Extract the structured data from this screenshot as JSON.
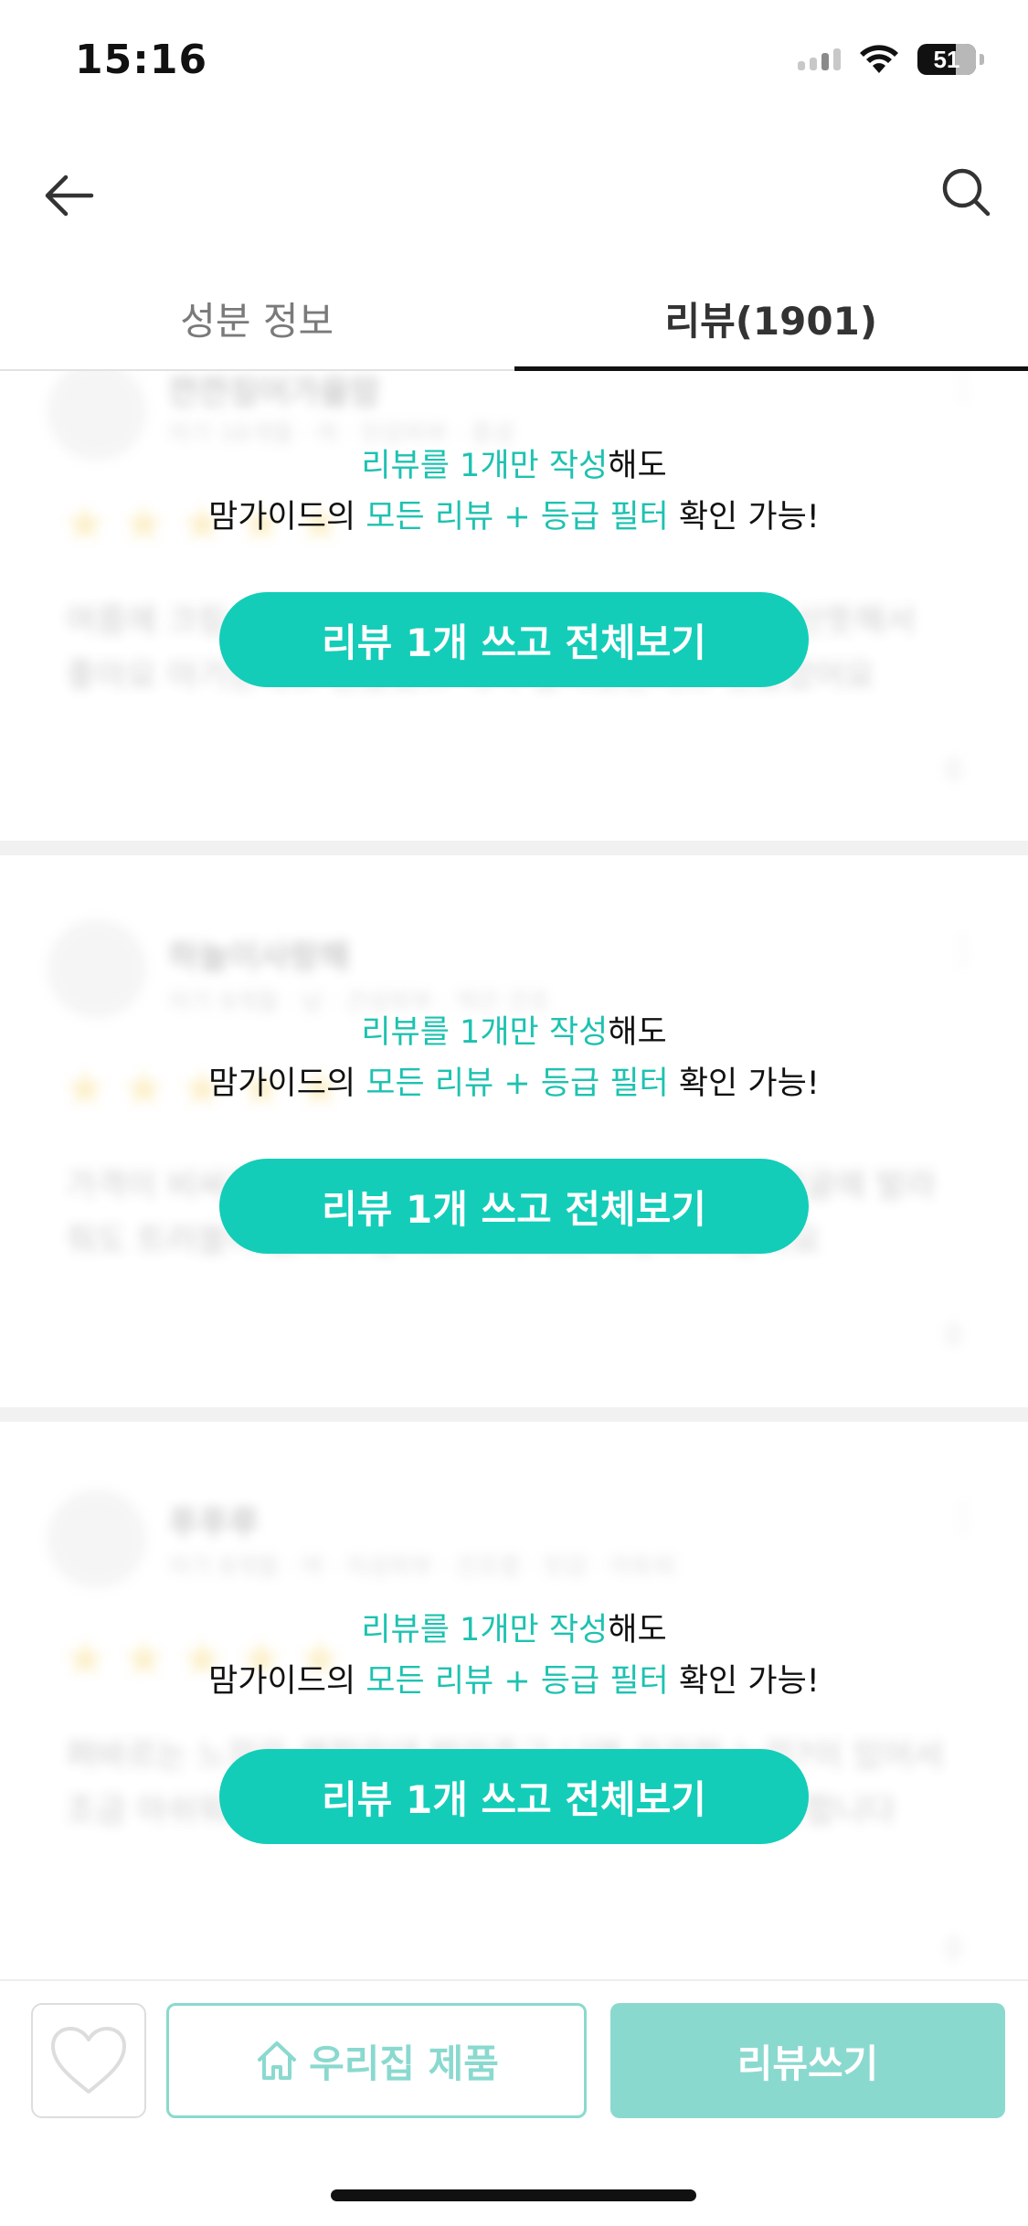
{
  "status_bar": {
    "time": "15:16",
    "battery": "51"
  },
  "tabs": [
    {
      "label": "성분 정보",
      "active": false
    },
    {
      "label": "리뷰(1901)",
      "active": true
    }
  ],
  "reviews": [
    {
      "name": "깐깐징어가을맘",
      "meta": "아기 16개월 · 여 · 민감피부 · 중성",
      "text": "여름에 크림 바르기 답답해서 사용해봤는데 촉촉하고 산뜻해서 좋아요 아기한테도 괜찮았고 제가 발라봤는데도 괜찮았어요",
      "likes": "0"
    },
    {
      "name": "하늘이사랑해",
      "meta": "아기 9개월 · 남 · 건성피부 · 약간 건조",
      "text": "가격이 비싸지 않은데 보습력이 좋아요 순해서 아기 얼굴에 발라줘도 트러블이 없어서 좋아요!! 아기도 사용하기 좋아요",
      "likes": "0"
    },
    {
      "name": "푸푸루",
      "meta": "아기 8개월 · 여 · 지성피부 · 건조함 · 민감 · 아토피",
      "text": "펴바르는 느낌은 괜찮은데 발라주고 나면 끈끈한 느낌?이 있어서 조금 아쉬워요 보습은 잘 되는거 같긴 하지만 무난무난합니다",
      "likes": "0"
    }
  ],
  "overlay": {
    "line1_accent": "리뷰를 1개만 작성",
    "line1_rest": "해도",
    "line2_pre": "맘가이드의 ",
    "line2_accent": "모든 리뷰 + 등급 필터",
    "line2_rest": " 확인 가능!",
    "cta_label": "리뷰 1개 쓰고 전체보기"
  },
  "bottom_bar": {
    "home_label": "우리집 제품",
    "write_label": "리뷰쓰기"
  },
  "colors": {
    "accent": "#13cdb8",
    "accent_text": "#1dc2b0",
    "muted_accent": "#8ad9cf"
  }
}
